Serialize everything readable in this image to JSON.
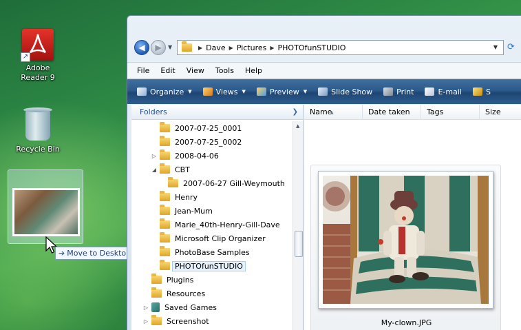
{
  "desktop": {
    "icons": [
      {
        "label_line1": "Adobe",
        "label_line2": "Reader 9"
      },
      {
        "label": "Recycle Bin"
      }
    ],
    "tooltip": "Move to Desktop"
  },
  "address": {
    "crumbs": [
      "Dave",
      "Pictures",
      "PHOTOfunSTUDIO"
    ]
  },
  "menu": [
    "File",
    "Edit",
    "View",
    "Tools",
    "Help"
  ],
  "commands": [
    "Organize",
    "Views",
    "Preview",
    "Slide Show",
    "Print",
    "E-mail",
    "S"
  ],
  "navpane": {
    "header": "Folders",
    "items": [
      {
        "label": "2007-07-25_0001",
        "level": 2
      },
      {
        "label": "2007-07-25_0002",
        "level": 2
      },
      {
        "label": "2008-04-06",
        "level": 2,
        "expander": "▷"
      },
      {
        "label": "CBT",
        "level": 2,
        "expander": "◢"
      },
      {
        "label": "2007-06-27 Gill-Weymouth",
        "level": 3
      },
      {
        "label": "Henry",
        "level": 2
      },
      {
        "label": "Jean-Mum",
        "level": 2
      },
      {
        "label": "Marie_40th-Henry-Gill-Dave",
        "level": 2
      },
      {
        "label": "Microsoft Clip Organizer",
        "level": 2
      },
      {
        "label": "PhotoBase Samples",
        "level": 2
      },
      {
        "label": "PHOTOfunSTUDIO",
        "level": 2,
        "selected": true
      },
      {
        "label": "Plugins",
        "level": 1
      },
      {
        "label": "Resources",
        "level": 1
      },
      {
        "label": "Saved Games",
        "level": 1,
        "expander": "▷",
        "icon": "games"
      },
      {
        "label": "Screenshot",
        "level": 1,
        "expander": "▷"
      }
    ]
  },
  "columns": [
    "Name",
    "Date taken",
    "Tags",
    "Size"
  ],
  "file": {
    "name": "My-clown.JPG"
  },
  "colors": {
    "command_bar": "#2c5a8a",
    "folder_yellow": "#e0a526",
    "selection": "#e6f1fb",
    "header_link": "#1c4d95"
  }
}
